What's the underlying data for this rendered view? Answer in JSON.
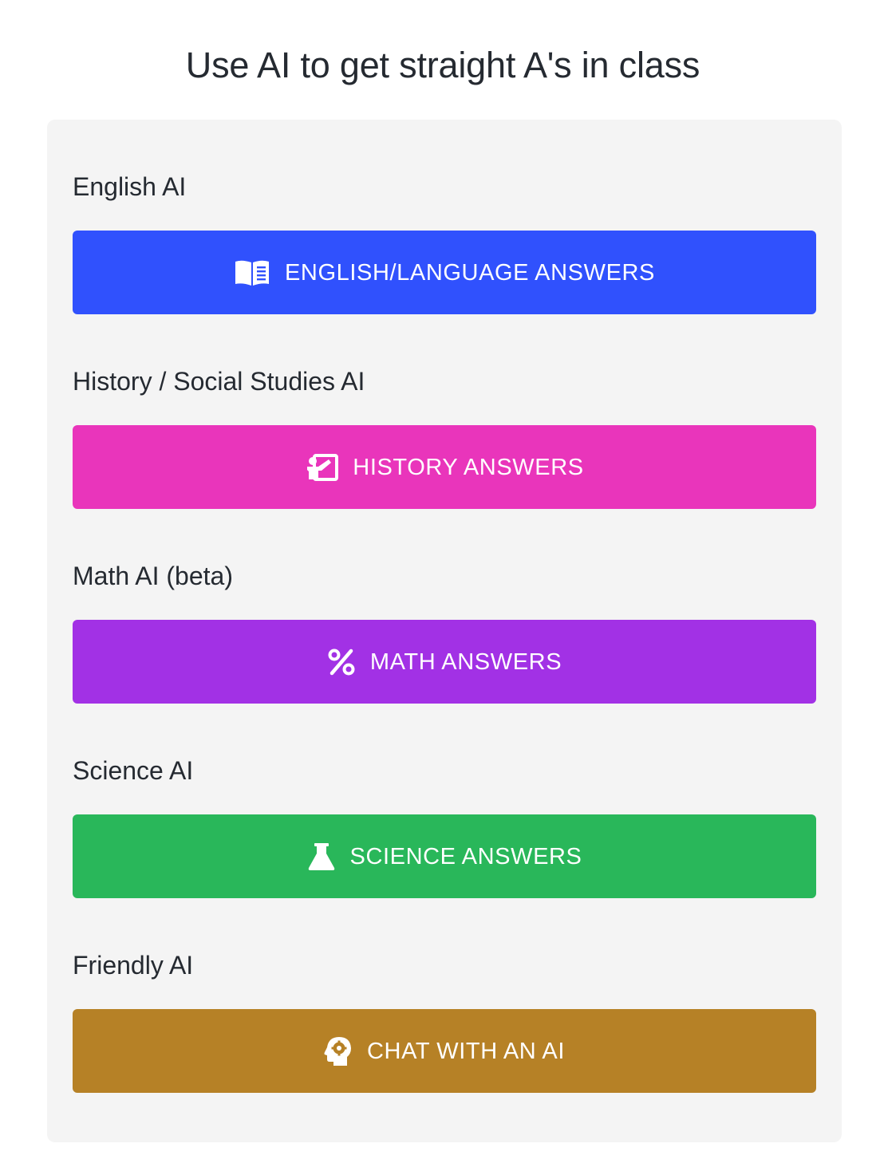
{
  "page": {
    "title": "Use AI to get straight A's in class"
  },
  "sections": [
    {
      "label": "English AI",
      "button_label": "ENGLISH/LANGUAGE ANSWERS",
      "icon": "book-reader-icon",
      "color": "#3051fd"
    },
    {
      "label": "History / Social Studies AI",
      "button_label": "HISTORY ANSWERS",
      "icon": "chalkboard-teacher-icon",
      "color": "#e935bb"
    },
    {
      "label": "Math AI (beta)",
      "button_label": "MATH ANSWERS",
      "icon": "percent-icon",
      "color": "#a231e5"
    },
    {
      "label": "Science AI",
      "button_label": "SCIENCE ANSWERS",
      "icon": "flask-icon",
      "color": "#29b75a"
    },
    {
      "label": "Friendly AI",
      "button_label": "CHAT WITH AN AI",
      "icon": "head-gear-icon",
      "color": "#b68126"
    }
  ]
}
